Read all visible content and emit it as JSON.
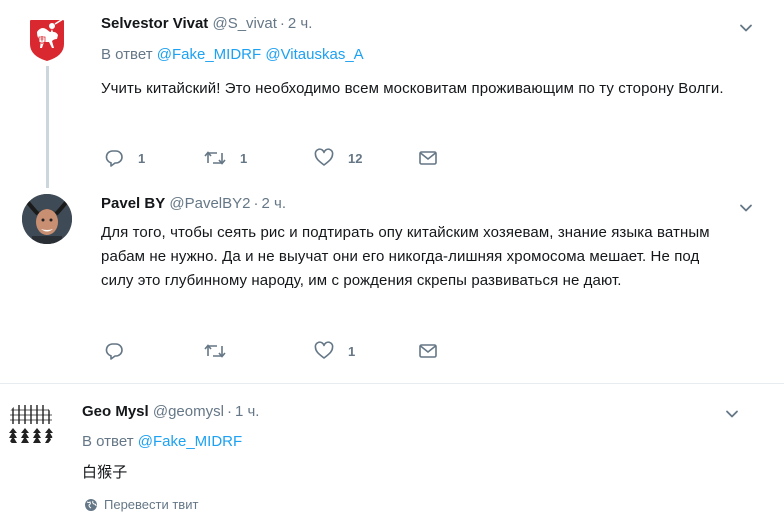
{
  "tweets": [
    {
      "name": "Selvestor Vivat",
      "handle": "@S_vivat",
      "dot": "·",
      "time": "2 ч.",
      "reply_prefix": "В ответ",
      "reply_to": [
        "@Fake_MIDRF",
        "@Vitauskas_A"
      ],
      "text": "Учить китайский! Это необходимо всем московитам проживающим по ту сторону Волги.",
      "replies": "1",
      "retweets": "1",
      "likes": "12",
      "avatar_icon": "pahonia-coat-of-arms"
    },
    {
      "name": "Pavel BY",
      "handle": "@PavelBY2",
      "dot": "·",
      "time": "2 ч.",
      "text": "Для того, чтобы сеять рис и подтирать опу китайским хозяевам, знание языка ватным рабам не нужно. Да и не выучат они его никогда-лишняя хромосома мешает. Не под силу это глубинному народу, им с рождения скрепы развиваться не дают.",
      "replies": "",
      "retweets": "",
      "likes": "1",
      "avatar_icon": "person-photo"
    },
    {
      "name": "Geo Mysl",
      "handle": "@geomysl",
      "dot": "·",
      "time": "1 ч.",
      "reply_prefix": "В ответ",
      "reply_to": [
        "@Fake_MIDRF"
      ],
      "text": "白猴子",
      "translate_label": "Перевести твит",
      "avatar_icon": "tree-pattern"
    }
  ],
  "colors": {
    "accent": "#1da1f2",
    "muted": "#657786",
    "text": "#14171a",
    "thread_line": "#ccd6dd",
    "avatar1_bg": "#d9282f"
  }
}
